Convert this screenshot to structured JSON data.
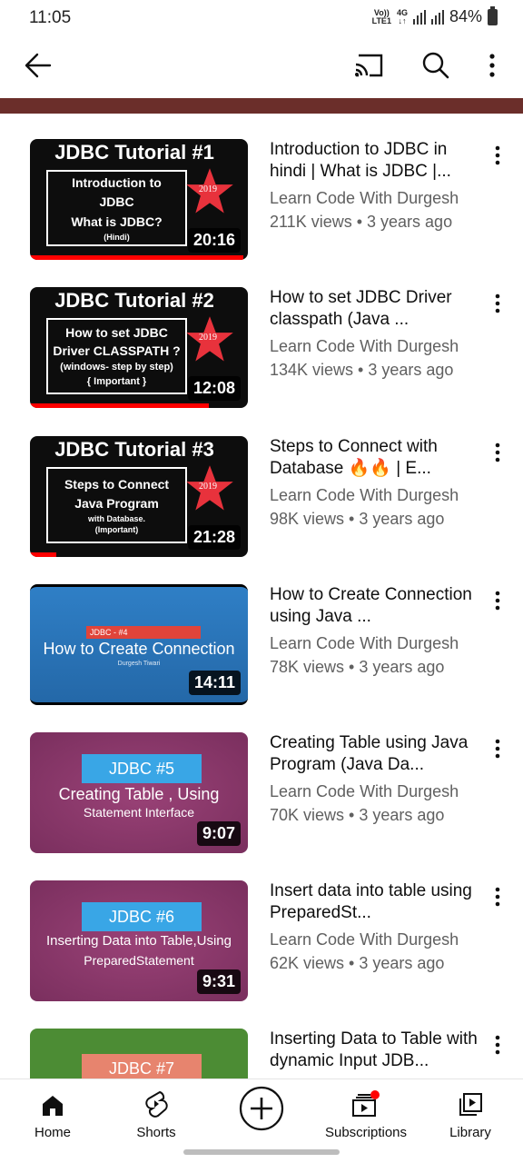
{
  "status": {
    "time": "11:05",
    "volte": "Vo)) LTE1",
    "network": "4G",
    "battery": "84%"
  },
  "topbar": {
    "back": "arrow-left",
    "cast": "cast",
    "search": "search",
    "more": "more-vert"
  },
  "videos": [
    {
      "title": "Introduction to JDBC in hindi | What is JDBC |...",
      "channel": "Learn Code With Durgesh",
      "meta": "211K views • 3 years ago",
      "duration": "20:16",
      "progress_pct": 98,
      "thumb": {
        "heading": "JDBC Tutorial #1",
        "lines": [
          "Introduction to",
          "JDBC",
          "What is JDBC?",
          "(Hindi)"
        ],
        "badge": "2019"
      }
    },
    {
      "title": "How to set JDBC Driver classpath (Java ...",
      "channel": "Learn Code With Durgesh",
      "meta": "134K views • 3 years ago",
      "duration": "12:08",
      "progress_pct": 82,
      "thumb": {
        "heading": "JDBC Tutorial #2",
        "lines": [
          "How to set JDBC",
          "Driver CLASSPATH ?",
          "(windows- step by step)",
          "{ Important }"
        ],
        "badge": "2019"
      }
    },
    {
      "title": "Steps to Connect with Database 🔥🔥 | E...",
      "channel": "Learn Code With Durgesh",
      "meta": "98K views • 3 years ago",
      "duration": "21:28",
      "progress_pct": 12,
      "thumb": {
        "heading": "JDBC Tutorial #3",
        "lines": [
          "Steps to Connect",
          "Java Program",
          "with Database.",
          "(Important)"
        ],
        "badge": "2019"
      }
    },
    {
      "title": "How to Create Connection  using Java ...",
      "channel": "Learn Code With Durgesh",
      "meta": "78K views • 3 years ago",
      "duration": "14:11",
      "thumb": {
        "tag": "JDBC - #4",
        "title": "How to Create Connection",
        "sub": "Durgesh Tiwari"
      }
    },
    {
      "title": "Creating Table using Java Program (Java Da...",
      "channel": "Learn Code With Durgesh",
      "meta": "70K views • 3 years ago",
      "duration": "9:07",
      "thumb": {
        "tag": "JDBC #5",
        "line1": "Creating Table , Using",
        "line2": "Statement Interface"
      }
    },
    {
      "title": "Insert data into table using PreparedSt...",
      "channel": "Learn Code With Durgesh",
      "meta": "62K views • 3 years ago",
      "duration": "9:31",
      "thumb": {
        "tag": "JDBC #6",
        "line1": "Inserting Data into Table,Using",
        "line2": "PreparedStatement"
      }
    },
    {
      "title": "Inserting Data to Table with dynamic Input JDB...",
      "thumb": {
        "tag": "JDBC #7"
      }
    }
  ],
  "nav": {
    "home": "Home",
    "shorts": "Shorts",
    "create": "create",
    "subscriptions": "Subscriptions",
    "library": "Library"
  },
  "colors": {
    "banner": "#6b2e2a",
    "progress": "#ff0000",
    "secondary_text": "#606060"
  }
}
